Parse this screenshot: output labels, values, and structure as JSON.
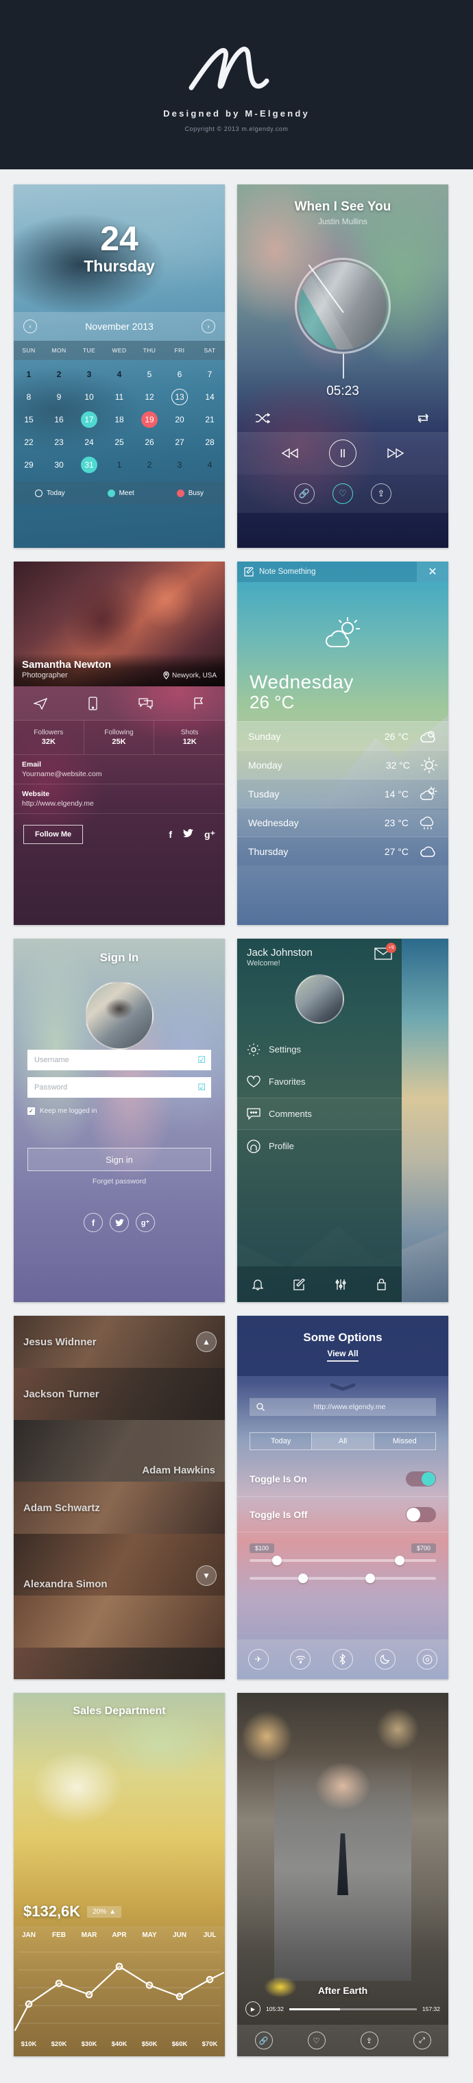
{
  "header": {
    "logo_name": "m-signature-logo",
    "designed_by": "Designed by M-Elgendy",
    "copyright": "Copyright © 2013 m.elgendy.com"
  },
  "calendar": {
    "day_number": "24",
    "day_name": "Thursday",
    "month_label": "November 2013",
    "prev_icon": "chevron-left-icon",
    "next_icon": "chevron-right-icon",
    "dow": [
      "SUN",
      "MON",
      "TUE",
      "WED",
      "THU",
      "FRI",
      "SAT"
    ],
    "weeks": [
      [
        {
          "d": "1",
          "s": "dark"
        },
        {
          "d": "2",
          "s": "dark"
        },
        {
          "d": "3",
          "s": "dark"
        },
        {
          "d": "4",
          "s": "dark"
        },
        {
          "d": "5",
          "s": ""
        },
        {
          "d": "6",
          "s": ""
        },
        {
          "d": "7",
          "s": ""
        }
      ],
      [
        {
          "d": "8",
          "s": ""
        },
        {
          "d": "9",
          "s": ""
        },
        {
          "d": "10",
          "s": ""
        },
        {
          "d": "11",
          "s": ""
        },
        {
          "d": "12",
          "s": ""
        },
        {
          "d": "13",
          "s": "today"
        },
        {
          "d": "14",
          "s": ""
        }
      ],
      [
        {
          "d": "15",
          "s": ""
        },
        {
          "d": "16",
          "s": ""
        },
        {
          "d": "17",
          "s": "meet"
        },
        {
          "d": "18",
          "s": ""
        },
        {
          "d": "19",
          "s": "busy"
        },
        {
          "d": "20",
          "s": ""
        },
        {
          "d": "21",
          "s": ""
        }
      ],
      [
        {
          "d": "22",
          "s": ""
        },
        {
          "d": "23",
          "s": ""
        },
        {
          "d": "24",
          "s": ""
        },
        {
          "d": "25",
          "s": ""
        },
        {
          "d": "26",
          "s": ""
        },
        {
          "d": "27",
          "s": ""
        },
        {
          "d": "28",
          "s": ""
        }
      ],
      [
        {
          "d": "29",
          "s": ""
        },
        {
          "d": "30",
          "s": ""
        },
        {
          "d": "31",
          "s": "meet"
        },
        {
          "d": "1",
          "s": "out"
        },
        {
          "d": "2",
          "s": "out"
        },
        {
          "d": "3",
          "s": "out"
        },
        {
          "d": "4",
          "s": "out"
        }
      ]
    ],
    "legend": [
      {
        "label": "Today",
        "color": "transparent",
        "hollow": true
      },
      {
        "label": "Meet",
        "color": "#4fd8d0",
        "hollow": false
      },
      {
        "label": "Busy",
        "color": "#f2606a",
        "hollow": false
      }
    ]
  },
  "music": {
    "title": "When I See You",
    "artist": "Justin Mullins",
    "time": "05:23",
    "shuffle_icon": "shuffle-icon",
    "repeat_icon": "repeat-icon",
    "prev_icon": "rewind-icon",
    "play_icon": "pause-icon",
    "next_icon": "fast-forward-icon",
    "footer_icons": [
      "link-icon",
      "heart-icon",
      "share-icon"
    ]
  },
  "profile": {
    "name": "Samantha Newton",
    "role": "Photographer",
    "location": "Newyork, USA",
    "location_icon": "map-pin-icon",
    "action_icons": [
      "send-icon",
      "phone-icon",
      "chat-icon",
      "flag-icon"
    ],
    "stats": [
      {
        "label": "Followers",
        "value": "32K"
      },
      {
        "label": "Following",
        "value": "25K"
      },
      {
        "label": "Shots",
        "value": "12K"
      }
    ],
    "email_label": "Email",
    "email_value": "Yourname@website.com",
    "website_label": "Website",
    "website_value": "http://www.elgendy.me",
    "follow_button": "Follow Me",
    "social_icons": [
      "facebook-icon",
      "twitter-icon",
      "google-plus-icon"
    ]
  },
  "weather": {
    "note_label": "Note Something",
    "note_icon": "compose-icon",
    "close_icon": "close-icon",
    "big_icon": "sun-cloud-icon",
    "day": "Wednesday",
    "temp": "26 °C",
    "forecast": [
      {
        "day": "Sunday",
        "temp": "26 °C",
        "icon": "cloud-sun-icon"
      },
      {
        "day": "Monday",
        "temp": "32 °C",
        "icon": "sun-icon"
      },
      {
        "day": "Tusday",
        "temp": "14 °C",
        "icon": "sun-cloud-small-icon"
      },
      {
        "day": "Wednesday",
        "temp": "23 °C",
        "icon": "cloud-rain-icon"
      },
      {
        "day": "Thursday",
        "temp": "27 °C",
        "icon": "cloud-icon"
      }
    ]
  },
  "signin": {
    "title": "Sign In",
    "avatar_name": "user-avatar",
    "username_placeholder": "Username",
    "password_placeholder": "Password",
    "field_check_icon": "check-box-icon",
    "keep_logged_label": "Keep me logged in",
    "submit_label": "Sign in",
    "forget_label": "Forget password",
    "social_icons": [
      "facebook-icon",
      "twitter-icon",
      "google-plus-icon"
    ]
  },
  "menu": {
    "name": "Jack Johnston",
    "welcome": "Welcome!",
    "mail_icon": "mail-icon",
    "mail_badge": "+9",
    "items": [
      {
        "label": "Settings",
        "icon": "gear-icon"
      },
      {
        "label": "Favorites",
        "icon": "heart-icon"
      },
      {
        "label": "Comments",
        "icon": "comment-icon"
      },
      {
        "label": "Profile",
        "icon": "profile-icon"
      }
    ],
    "bottom_icons": [
      "bell-icon",
      "compose-icon",
      "sliders-icon",
      "lock-icon"
    ]
  },
  "names": {
    "rows": [
      {
        "name": "Jesus Widnner",
        "align": "left"
      },
      {
        "name": "Jackson Turner",
        "align": "left"
      },
      {
        "name": "Adam Hawkins",
        "align": "right"
      },
      {
        "name": "Adam Schwartz",
        "align": "left"
      },
      {
        "name": "Alexandra Simon",
        "align": "left"
      }
    ],
    "up_icon": "chevron-up-icon",
    "down_icon": "chevron-down-icon"
  },
  "options": {
    "title": "Some Options",
    "view_all": "View All",
    "handle_icon": "drag-handle-icon",
    "search_icon": "search-icon",
    "search_value": "http://www.elgendy.me",
    "segments": [
      {
        "label": "Today",
        "selected": false
      },
      {
        "label": "All",
        "selected": true
      },
      {
        "label": "Missed",
        "selected": false
      }
    ],
    "toggles": [
      {
        "label": "Toggle Is On",
        "state": "on"
      },
      {
        "label": "Toggle Is Off",
        "state": "off"
      }
    ],
    "slider_min_badge": "$100",
    "slider_max_badge": "$700",
    "bottom_icons": [
      "airplane-icon",
      "wifi-icon",
      "bluetooth-icon",
      "moon-icon",
      "settings-icon"
    ]
  },
  "sales": {
    "title": "Sales Department",
    "amount": "$132,6K",
    "delta": "20%",
    "delta_icon": "arrow-up-icon"
  },
  "movie": {
    "title": "After Earth",
    "play_icon": "play-icon",
    "time_current": "105:32",
    "time_total": "157:32",
    "footer_icons": [
      "link-icon",
      "heart-icon",
      "share-icon",
      "expand-icon"
    ]
  },
  "chart_data": {
    "type": "line",
    "title": "Sales Department",
    "categories": [
      "JAN",
      "FEB",
      "MAR",
      "APR",
      "MAY",
      "JUN",
      "JUL"
    ],
    "x_tick_labels": [
      "$10K",
      "$20K",
      "$30K",
      "$40K",
      "$50K",
      "$60K",
      "$70K"
    ],
    "values": [
      22,
      44,
      32,
      62,
      42,
      30,
      48
    ],
    "ylim": [
      0,
      100
    ],
    "xlabel": "",
    "ylabel": "",
    "grid": true,
    "legend": "none",
    "annotation_value": "$132,6K",
    "annotation_delta": "20%"
  }
}
